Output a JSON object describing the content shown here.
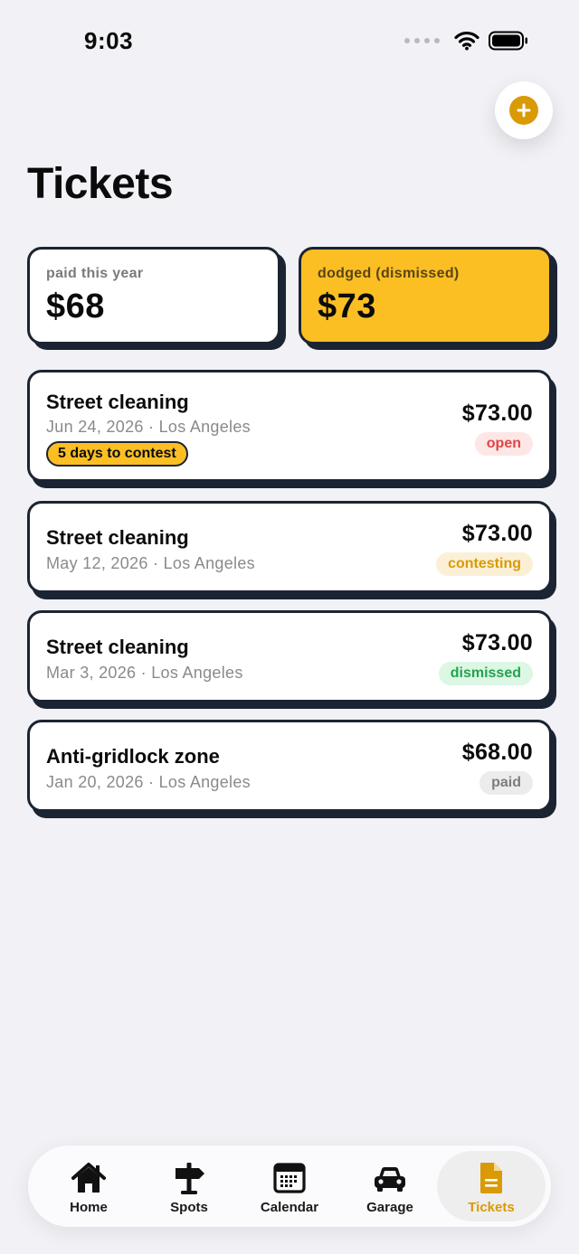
{
  "status_bar": {
    "time": "9:03"
  },
  "header": {
    "title": "Tickets",
    "add_icon": "plus-circle-icon"
  },
  "summary": {
    "paid": {
      "label": "paid this year",
      "value": "$68"
    },
    "dodged": {
      "label": "dodged (dismissed)",
      "value": "$73"
    }
  },
  "tickets": [
    {
      "title": "Street cleaning",
      "meta": "Jun 24, 2026 · Los Angeles",
      "amount": "$73.00",
      "status": "open",
      "contest": "5 days to contest"
    },
    {
      "title": "Street cleaning",
      "meta": "May 12, 2026 · Los Angeles",
      "amount": "$73.00",
      "status": "contesting"
    },
    {
      "title": "Street cleaning",
      "meta": "Mar 3, 2026 · Los Angeles",
      "amount": "$73.00",
      "status": "dismissed"
    },
    {
      "title": "Anti-gridlock zone",
      "meta": "Jan 20, 2026 · Los Angeles",
      "amount": "$68.00",
      "status": "paid"
    }
  ],
  "tabs": [
    {
      "label": "Home",
      "icon": "house-icon"
    },
    {
      "label": "Spots",
      "icon": "signpost-icon"
    },
    {
      "label": "Calendar",
      "icon": "calendar-icon"
    },
    {
      "label": "Garage",
      "icon": "car-icon"
    },
    {
      "label": "Tickets",
      "icon": "ticket-doc-icon",
      "active": true
    }
  ],
  "colors": {
    "accent": "#d99a06",
    "dodged_card": "#fbbf24",
    "card_border": "#1b2432",
    "status_open": "#e24444",
    "status_contesting": "#d99a06",
    "status_dismissed": "#23a34e",
    "status_paid": "#7d7d7d"
  }
}
